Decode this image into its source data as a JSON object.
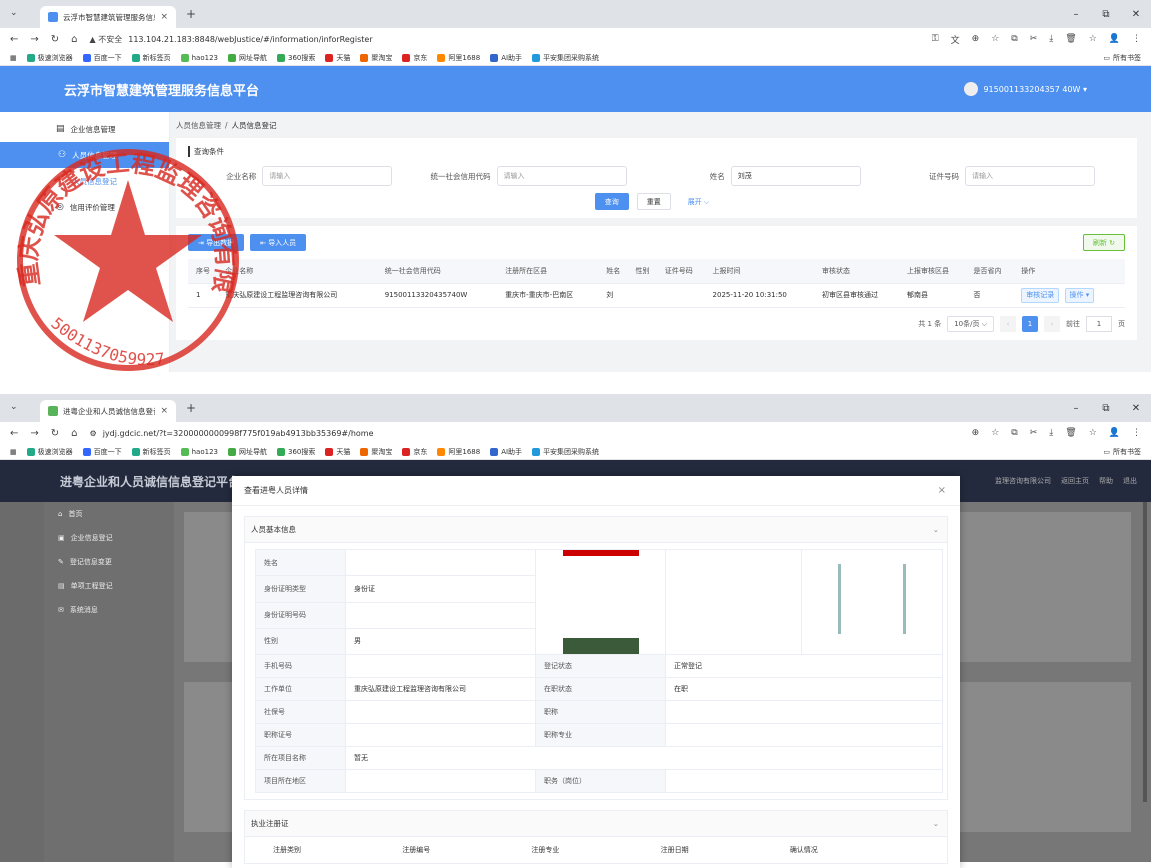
{
  "window1": {
    "tab": {
      "title": "云浮市智慧建筑管理服务信息平",
      "close": "×",
      "new": "+"
    },
    "window_controls": [
      "–",
      "⧉",
      "✕"
    ],
    "address": {
      "warning": "▲ 不安全",
      "url": "113.104.21.183:8848/webJustice/#/information/inforRegister"
    },
    "bookmarks": [
      "极速浏览器",
      "百度一下",
      "新标签页",
      "hao123",
      "网址导航",
      "360搜索",
      "天猫",
      "聚淘宝",
      "京东",
      "阿里1688",
      "AI助手",
      "平安集团采购系统"
    ],
    "bookmarks_right": "所有书签",
    "app_title": "云浮市智慧建筑管理服务信息平台",
    "user": "915001133204357 40W ▾",
    "sidebar": [
      {
        "label": "企业信息管理",
        "icon": "▤"
      },
      {
        "label": "人员信息管理",
        "icon": "⚇"
      },
      {
        "label": "人员信息登记",
        "icon": ""
      },
      {
        "label": "信用评价管理",
        "icon": "◎"
      }
    ],
    "breadcrumb": {
      "parent": "人员信息管理",
      "sep": "/",
      "current": "人员信息登记"
    },
    "query": {
      "title": "查询条件",
      "fields": [
        {
          "label": "企业名称",
          "value": "",
          "placeholder": "请输入"
        },
        {
          "label": "统一社会信用代码",
          "value": "",
          "placeholder": "请输入"
        },
        {
          "label": "姓名",
          "value": "刘茂",
          "placeholder": ""
        },
        {
          "label": "证件号码",
          "value": "",
          "placeholder": "请输入"
        }
      ],
      "search": "查询",
      "reset": "重置",
      "expand": "展开 ⌵"
    },
    "toolbar": {
      "export": "导出数据",
      "import": "导入人员",
      "refresh": "刷新 ↻"
    },
    "table": {
      "headers": [
        "序号",
        "企业名称",
        "统一社会信用代码",
        "注册所在区县",
        "姓名",
        "性别",
        "证件号码",
        "上报时间",
        "审核状态",
        "上报审核区县",
        "是否省内",
        "操作"
      ],
      "rows": [
        {
          "no": "1",
          "company": "重庆弘原建设工程监理咨询有限公司",
          "code": "91500113320435740W",
          "district": "重庆市-重庆市-巴南区",
          "name": "刘",
          "gender": "",
          "id": "",
          "time": "2025-11-20 10:31:50",
          "status": "初审区县审核通过",
          "audit_district": "郁南县",
          "in_province": "否",
          "btn_audit": "审核记录",
          "btn_op": "操作 ▾"
        }
      ]
    },
    "pager": {
      "total": "共 1 条",
      "size": "10条/页 ⌵",
      "prev": "‹",
      "page": "1",
      "next": "›",
      "goto": "前往",
      "goto_val": "1",
      "unit": "页"
    }
  },
  "stamp": {
    "text": "重庆弘原建设工程监理咨询有限公司",
    "number": "5001137059927"
  },
  "window2": {
    "tab": {
      "title": "进粤企业和人员诚信信息登记",
      "close": "×",
      "new": "+"
    },
    "address": {
      "url": "jydj.gdcic.net/?t=3200000000998f775f019ab4913bb35369#/home"
    },
    "app_title": "进粤企业和人员诚信信息登记平台",
    "header_right": [
      "监理咨询有限公司",
      "返回主页",
      "帮助",
      "退出"
    ],
    "sidebar": [
      "首页",
      "企业信息登记",
      "登记信息变更",
      "单项工程登记",
      "系统消息"
    ],
    "modal": {
      "title": "查看进粤人员详情",
      "section1": "人员基本信息",
      "rows": [
        {
          "k": "姓名",
          "v": ""
        },
        {
          "k": "身份证明类型",
          "v": "身份证"
        },
        {
          "k": "身份证明号码",
          "v": ""
        },
        {
          "k": "性别",
          "v": "男"
        }
      ],
      "grid": [
        [
          "手机号码",
          "",
          "登记状态",
          "正常登记"
        ],
        [
          "工作单位",
          "重庆弘原建设工程监理咨询有限公司",
          "在职状态",
          "在职"
        ],
        [
          "社保号",
          "",
          "职称",
          ""
        ],
        [
          "职称证号",
          "",
          "职称专业",
          ""
        ],
        [
          "所在项目名称",
          "暂无",
          "",
          ""
        ],
        [
          "项目所在地区",
          "",
          "职务（岗位）",
          ""
        ]
      ],
      "section2": "执业注册证",
      "reg_headers": [
        "注册类别",
        "注册编号",
        "注册专业",
        "注册日期",
        "确认情况"
      ]
    }
  },
  "colors": {
    "primary": "#4d90f0",
    "stamp_red": "#d8281f"
  }
}
